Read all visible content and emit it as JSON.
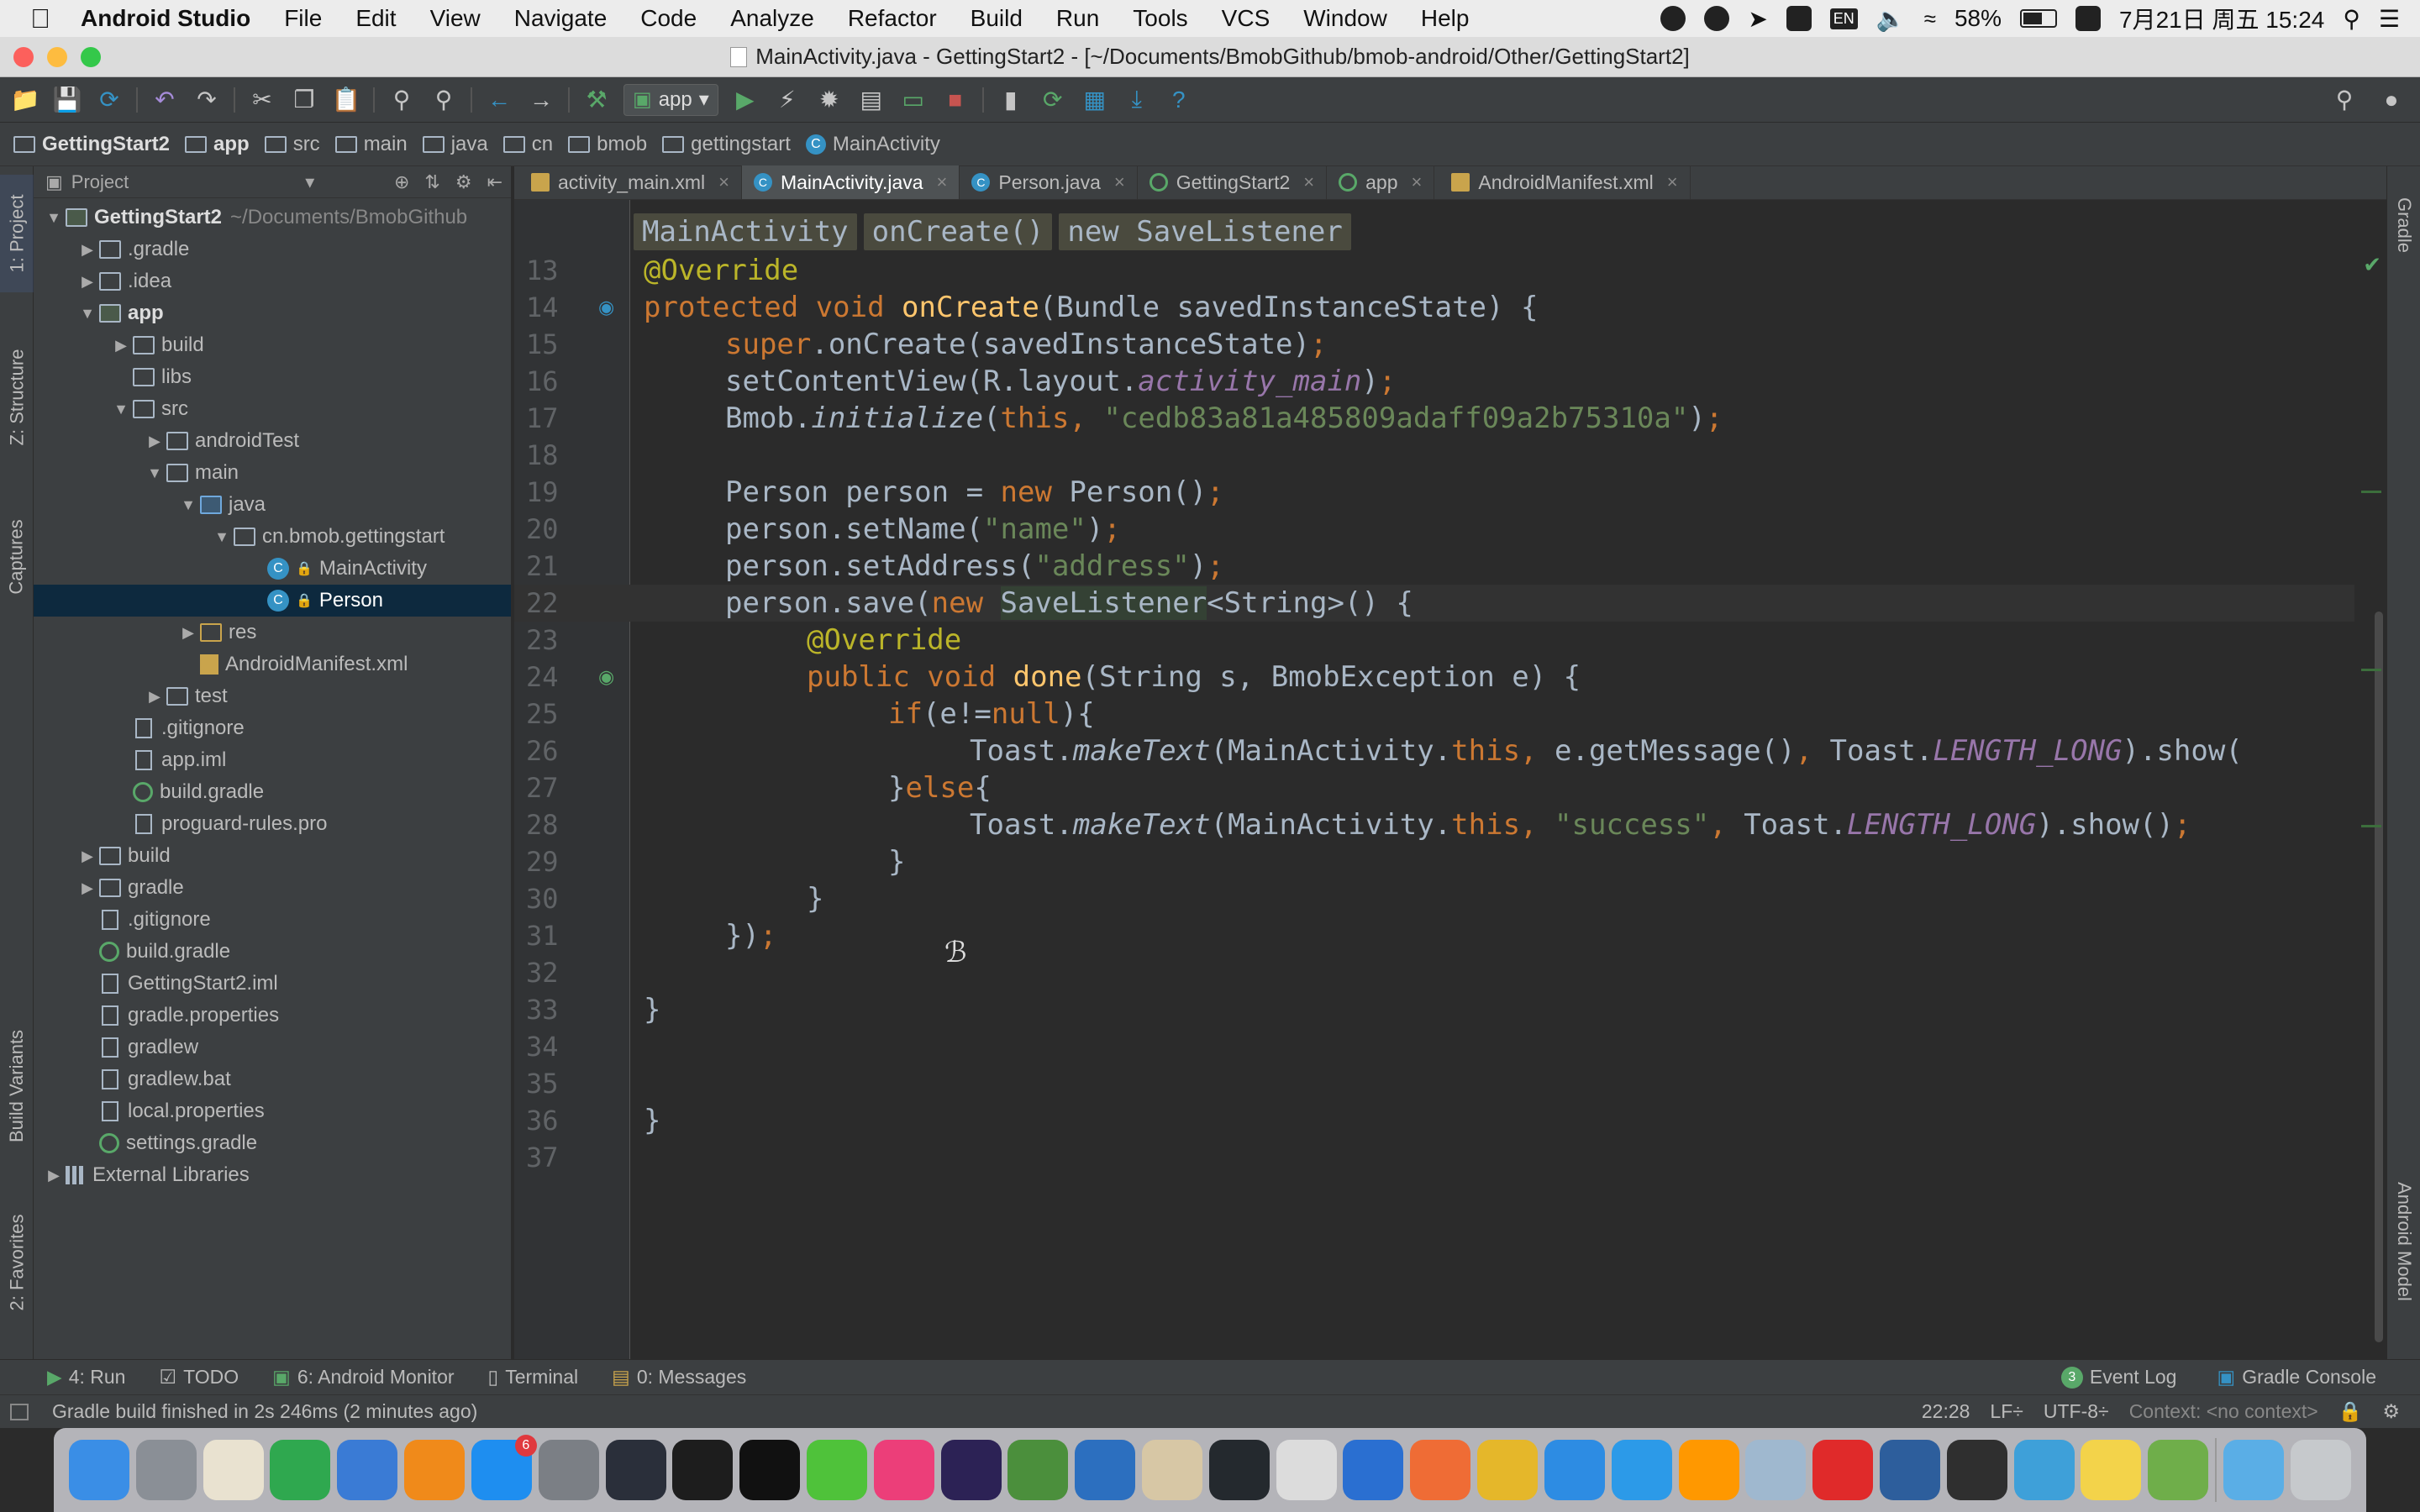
{
  "menubar": {
    "apple": "",
    "app_name": "Android Studio",
    "items": [
      "File",
      "Edit",
      "View",
      "Navigate",
      "Code",
      "Analyze",
      "Refactor",
      "Build",
      "Run",
      "Tools",
      "VCS",
      "Window",
      "Help"
    ],
    "input_method": "EN",
    "battery": "58%",
    "clock": "7月21日 周五 15:24"
  },
  "window": {
    "title": "MainActivity.java - GettingStart2 - [~/Documents/BmobGithub/bmob-android/Other/GettingStart2]"
  },
  "toolbar": {
    "run_config": "app"
  },
  "breadcrumbs": [
    "GettingStart2",
    "app",
    "src",
    "main",
    "java",
    "cn",
    "bmob",
    "gettingstart",
    "MainActivity"
  ],
  "left_strip": {
    "project": "1: Project",
    "structure": "Z: Structure",
    "captures": "Captures",
    "build_variants": "Build Variants",
    "favorites": "2: Favorites"
  },
  "right_strip": {
    "gradle": "Gradle",
    "android_model": "Android Model"
  },
  "project_panel": {
    "header": "Project",
    "tree": [
      {
        "label": "GettingStart2",
        "extra": "~/Documents/BmobGithub",
        "depth": 0,
        "arrow": "open",
        "icon": "module",
        "bold": true
      },
      {
        "label": ".gradle",
        "depth": 1,
        "arrow": "closed",
        "icon": "folder"
      },
      {
        "label": ".idea",
        "depth": 1,
        "arrow": "closed",
        "icon": "folder"
      },
      {
        "label": "app",
        "depth": 1,
        "arrow": "open",
        "icon": "module",
        "bold": true
      },
      {
        "label": "build",
        "depth": 2,
        "arrow": "closed",
        "icon": "folder"
      },
      {
        "label": "libs",
        "depth": 2,
        "arrow": "none",
        "icon": "folder"
      },
      {
        "label": "src",
        "depth": 2,
        "arrow": "open",
        "icon": "folder"
      },
      {
        "label": "androidTest",
        "depth": 3,
        "arrow": "closed",
        "icon": "folder"
      },
      {
        "label": "main",
        "depth": 3,
        "arrow": "open",
        "icon": "folder"
      },
      {
        "label": "java",
        "depth": 4,
        "arrow": "open",
        "icon": "folder-blue"
      },
      {
        "label": "cn.bmob.gettingstart",
        "depth": 5,
        "arrow": "open",
        "icon": "folder"
      },
      {
        "label": "MainActivity",
        "depth": 6,
        "arrow": "none",
        "icon": "class",
        "lock": true
      },
      {
        "label": "Person",
        "depth": 6,
        "arrow": "none",
        "icon": "class",
        "lock": true,
        "selected": true
      },
      {
        "label": "res",
        "depth": 4,
        "arrow": "closed",
        "icon": "folder-res"
      },
      {
        "label": "AndroidManifest.xml",
        "depth": 4,
        "arrow": "none",
        "icon": "xml"
      },
      {
        "label": "test",
        "depth": 3,
        "arrow": "closed",
        "icon": "folder"
      },
      {
        "label": ".gitignore",
        "depth": 2,
        "arrow": "none",
        "icon": "file"
      },
      {
        "label": "app.iml",
        "depth": 2,
        "arrow": "none",
        "icon": "file"
      },
      {
        "label": "build.gradle",
        "depth": 2,
        "arrow": "none",
        "icon": "gradle"
      },
      {
        "label": "proguard-rules.pro",
        "depth": 2,
        "arrow": "none",
        "icon": "file"
      },
      {
        "label": "build",
        "depth": 1,
        "arrow": "closed",
        "icon": "folder"
      },
      {
        "label": "gradle",
        "depth": 1,
        "arrow": "closed",
        "icon": "folder"
      },
      {
        "label": ".gitignore",
        "depth": 1,
        "arrow": "none",
        "icon": "file"
      },
      {
        "label": "build.gradle",
        "depth": 1,
        "arrow": "none",
        "icon": "gradle"
      },
      {
        "label": "GettingStart2.iml",
        "depth": 1,
        "arrow": "none",
        "icon": "file"
      },
      {
        "label": "gradle.properties",
        "depth": 1,
        "arrow": "none",
        "icon": "file"
      },
      {
        "label": "gradlew",
        "depth": 1,
        "arrow": "none",
        "icon": "file"
      },
      {
        "label": "gradlew.bat",
        "depth": 1,
        "arrow": "none",
        "icon": "file"
      },
      {
        "label": "local.properties",
        "depth": 1,
        "arrow": "none",
        "icon": "file"
      },
      {
        "label": "settings.gradle",
        "depth": 1,
        "arrow": "none",
        "icon": "gradle"
      },
      {
        "label": "External Libraries",
        "depth": 0,
        "arrow": "closed",
        "icon": "lib"
      }
    ]
  },
  "editor": {
    "tabs": [
      {
        "label": "activity_main.xml",
        "icon": "xml",
        "active": false
      },
      {
        "label": "MainActivity.java",
        "icon": "class",
        "active": true
      },
      {
        "label": "Person.java",
        "icon": "class",
        "active": false
      },
      {
        "label": "GettingStart2",
        "icon": "gradle",
        "active": false
      },
      {
        "label": "app",
        "icon": "gradle",
        "active": false
      },
      {
        "label": "AndroidManifest.xml",
        "icon": "xml",
        "active": false
      }
    ],
    "scope_crumbs": [
      "MainActivity",
      "onCreate()",
      "new SaveListener"
    ],
    "lines": [
      {
        "n": "13",
        "indent": 1,
        "tokens": [
          [
            "an",
            "@Override"
          ]
        ]
      },
      {
        "n": "14",
        "indent": 1,
        "mark": "override",
        "tokens": [
          [
            "kw",
            "protected void "
          ],
          [
            "fn",
            "onCreate"
          ],
          [
            "",
            "(Bundle savedInstanceState) {"
          ]
        ]
      },
      {
        "n": "15",
        "indent": 2,
        "tokens": [
          [
            "kw",
            "super"
          ],
          [
            "",
            ".onCreate(savedInstanceState)"
          ],
          [
            "kw",
            ";"
          ]
        ]
      },
      {
        "n": "16",
        "indent": 2,
        "tokens": [
          [
            "",
            "setContentView(R.layout."
          ],
          [
            "cst",
            "activity_main"
          ],
          [
            "",
            ")"
          ],
          [
            "kw",
            ";"
          ]
        ]
      },
      {
        "n": "17",
        "indent": 2,
        "tokens": [
          [
            "",
            "Bmob."
          ],
          [
            "it",
            "initialize"
          ],
          [
            "",
            "("
          ],
          [
            "kw",
            "this, "
          ],
          [
            "str",
            "\"cedb83a81a485809adaff09a2b75310a\""
          ],
          [
            "",
            ")"
          ],
          [
            "kw",
            ";"
          ]
        ]
      },
      {
        "n": "18",
        "indent": 0,
        "tokens": []
      },
      {
        "n": "19",
        "indent": 2,
        "tokens": [
          [
            "",
            "Person person = "
          ],
          [
            "kw",
            "new "
          ],
          [
            "",
            "Person()"
          ],
          [
            "kw",
            ";"
          ]
        ]
      },
      {
        "n": "20",
        "indent": 2,
        "tokens": [
          [
            "",
            "person.setName("
          ],
          [
            "str",
            "\"name\""
          ],
          [
            "",
            ")"
          ],
          [
            "kw",
            ";"
          ]
        ]
      },
      {
        "n": "21",
        "indent": 2,
        "tokens": [
          [
            "",
            "person.setAddress("
          ],
          [
            "str",
            "\"address\""
          ],
          [
            "",
            ")"
          ],
          [
            "kw",
            ";"
          ]
        ]
      },
      {
        "n": "22",
        "indent": 2,
        "caret": true,
        "tokens": [
          [
            "",
            "person.save("
          ],
          [
            "kw",
            "new "
          ],
          [
            "hl",
            "SaveListener"
          ],
          [
            "",
            "<String>() {"
          ]
        ]
      },
      {
        "n": "23",
        "indent": 3,
        "tokens": [
          [
            "an",
            "@Override"
          ]
        ]
      },
      {
        "n": "24",
        "indent": 3,
        "mark": "implements",
        "tokens": [
          [
            "kw",
            "public void "
          ],
          [
            "fn",
            "done"
          ],
          [
            "",
            "(String s, BmobException e) {"
          ]
        ]
      },
      {
        "n": "25",
        "indent": 4,
        "tokens": [
          [
            "kw",
            "if"
          ],
          [
            "",
            "(e!="
          ],
          [
            "kw",
            "null"
          ],
          [
            "",
            "){"
          ]
        ]
      },
      {
        "n": "26",
        "indent": 5,
        "tokens": [
          [
            "",
            "Toast."
          ],
          [
            "it",
            "makeText"
          ],
          [
            "",
            "(MainActivity."
          ],
          [
            "kw",
            "this, "
          ],
          [
            "",
            "e.getMessage()"
          ],
          [
            "kw",
            ", "
          ],
          [
            "",
            "Toast."
          ],
          [
            "cst",
            "LENGTH_LONG"
          ],
          [
            "",
            ").show("
          ]
        ]
      },
      {
        "n": "27",
        "indent": 4,
        "tokens": [
          [
            "",
            "}"
          ],
          [
            "kw",
            "else"
          ],
          [
            "",
            "{"
          ]
        ]
      },
      {
        "n": "28",
        "indent": 5,
        "tokens": [
          [
            "",
            "Toast."
          ],
          [
            "it",
            "makeText"
          ],
          [
            "",
            "(MainActivity."
          ],
          [
            "kw",
            "this, "
          ],
          [
            "str",
            "\"success\""
          ],
          [
            "kw",
            ", "
          ],
          [
            "",
            "Toast."
          ],
          [
            "cst",
            "LENGTH_LONG"
          ],
          [
            "",
            ").show()"
          ],
          [
            "kw",
            ";"
          ]
        ]
      },
      {
        "n": "29",
        "indent": 4,
        "tokens": [
          [
            "",
            "}"
          ]
        ]
      },
      {
        "n": "30",
        "indent": 3,
        "tokens": [
          [
            "",
            "}"
          ]
        ]
      },
      {
        "n": "31",
        "indent": 2,
        "tokens": [
          [
            "",
            "})"
          ],
          [
            "kw",
            ";"
          ]
        ]
      },
      {
        "n": "32",
        "indent": 0,
        "tokens": []
      },
      {
        "n": "33",
        "indent": 1,
        "tokens": [
          [
            "",
            "}"
          ]
        ]
      },
      {
        "n": "34",
        "indent": 0,
        "tokens": []
      },
      {
        "n": "35",
        "indent": 0,
        "tokens": []
      },
      {
        "n": "36",
        "indent": 0,
        "tokens": [
          [
            "",
            "}"
          ]
        ]
      },
      {
        "n": "37",
        "indent": 0,
        "tokens": []
      }
    ]
  },
  "bottom_tabs": {
    "run": "4: Run",
    "todo": "TODO",
    "android_monitor": "6: Android Monitor",
    "terminal": "Terminal",
    "messages": "0: Messages",
    "event_log": "Event Log",
    "event_log_count": "3",
    "gradle_console": "Gradle Console"
  },
  "status": {
    "message": "Gradle build finished in 2s 246ms (2 minutes ago)",
    "position": "22:28",
    "line_sep": "LF÷",
    "encoding": "UTF-8÷",
    "context": "Context: <no context>"
  },
  "dock": {
    "app_store_badge": "6",
    "icons": [
      "finder",
      "launchpad",
      "textedit",
      "numbers",
      "keynote",
      "ibooks",
      "app-store",
      "system-preferences",
      "quicktime",
      "terminal",
      "qq",
      "wechat",
      "intellij",
      "eclipse",
      "android-studio",
      "xcode",
      "coffee",
      "github",
      "vase",
      "shark",
      "postman",
      "chrome",
      "safari",
      "feather",
      "sublime",
      "photos",
      "youdao",
      "virtualbox",
      "activity-monitor",
      "network",
      "stickies",
      "notebook",
      "downloads",
      "trash"
    ],
    "colors": {
      "finder": "#3a8ee6",
      "launchpad": "#8a8f96",
      "textedit": "#e9e2d0",
      "numbers": "#2fa84f",
      "keynote": "#3a7bd5",
      "ibooks": "#f08a1a",
      "app-store": "#1e8ef0",
      "system-preferences": "#7b7f85",
      "quicktime": "#2a2f3a",
      "terminal": "#1d1d1d",
      "qq": "#111111",
      "wechat": "#4fc23a",
      "intellij": "#ec3e79",
      "eclipse": "#2c2255",
      "android-studio": "#4b8f3c",
      "xcode": "#2c6fbf",
      "coffee": "#d7c7a5",
      "github": "#24292e",
      "vase": "#dcdcdc",
      "shark": "#2a6fd1",
      "postman": "#ef6c35",
      "chrome": "#e5b72a",
      "safari": "#2d8ce3",
      "feather": "#2c9ae8",
      "sublime": "#ff9800",
      "photos": "#9fb8cf",
      "youdao": "#e02a2a",
      "virtualbox": "#2d5e9c",
      "activity-monitor": "#2f2f2f",
      "network": "#3ea0d9",
      "stickies": "#f3d34a",
      "notebook": "#6fae4a",
      "downloads": "#5aaee6",
      "trash": "#c6c9cc"
    }
  }
}
